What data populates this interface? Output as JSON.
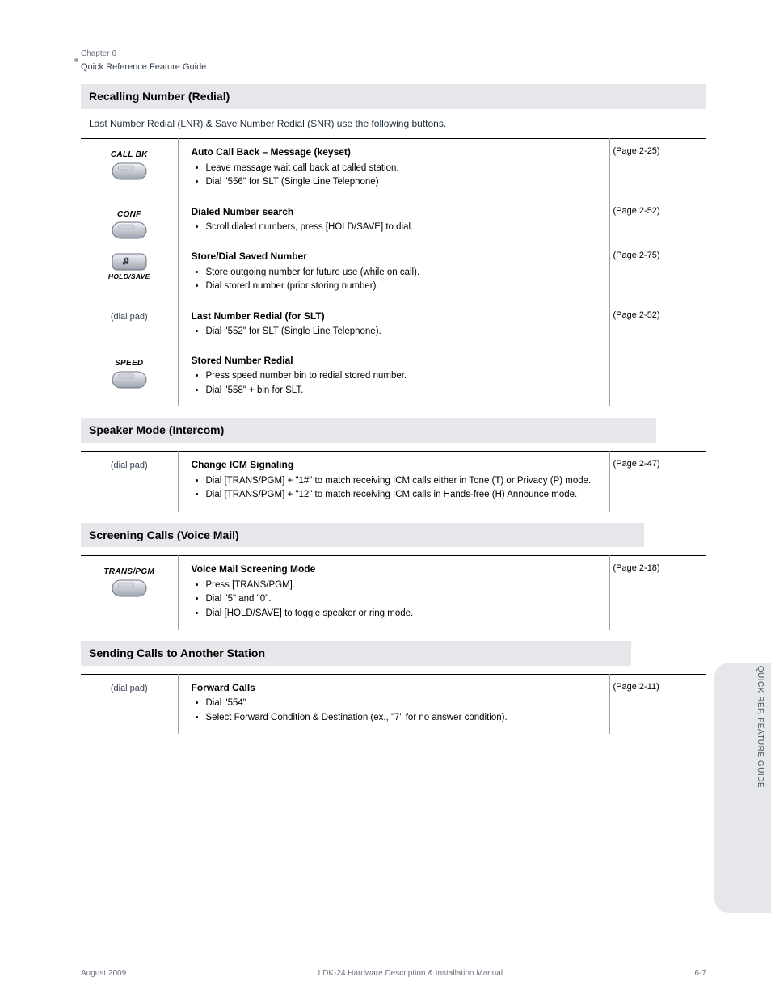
{
  "chapter": {
    "label": "Chapter 6",
    "title": "Quick Reference Feature Guide"
  },
  "sidebar_tab": "QUICK REF. FEATURE GUIDE",
  "footer": {
    "left": "August 2009",
    "center": "LDK-24 Hardware Description & Installation Manual",
    "right": "6-7"
  },
  "sections": [
    {
      "id": "recalling_redial",
      "title": "Recalling Number (Redial)",
      "width_class": "",
      "desc": "Last Number Redial (LNR) & Save Number Redial (SNR) use the following buttons.",
      "rows": [
        {
          "button_type": "image",
          "button_label": "CALL BK",
          "button_name": "call-back-button",
          "feature": "Auto Call Back – Message (keyset)",
          "items": [
            "Leave message wait call back at called station.",
            "Dial \"556\" for SLT (Single Line Telephone)"
          ],
          "ref": "(Page 2-25)"
        },
        {
          "button_type": "image",
          "button_label": "CONF",
          "button_name": "conf-button",
          "feature": "Dialed Number search",
          "items": [
            "Scroll dialed numbers, press [HOLD/SAVE] to dial."
          ],
          "ref": "(Page 2-52)"
        },
        {
          "button_type": "image",
          "button_label_top": "",
          "music_icon": true,
          "button_sublabel": "HOLD/SAVE",
          "button_name": "hold-save-button",
          "feature": "Store/Dial Saved Number",
          "items": [
            "Store outgoing number for future use (while on call).",
            "Dial stored number (prior storing number)."
          ],
          "ref": "(Page 2-75)"
        },
        {
          "button_type": "text",
          "button_text": "(dial pad)",
          "button_name": "dial-pad-label",
          "feature": "Last Number Redial (for SLT)",
          "items": [
            "Dial \"552\" for SLT (Single Line Telephone)."
          ],
          "ref": "(Page 2-52)"
        },
        {
          "button_type": "image",
          "button_label": "SPEED",
          "button_name": "speed-button",
          "feature": "Stored Number Redial",
          "items": [
            "Press speed number bin to redial stored number.",
            "Dial \"558\" + bin for SLT."
          ],
          "ref": ""
        }
      ]
    },
    {
      "id": "speaker_mode",
      "title": "Speaker Mode (Intercom)",
      "width_class": "w92",
      "desc": "",
      "rows": [
        {
          "button_type": "text",
          "button_text": "(dial pad)",
          "button_name": "dial-pad-label-2",
          "feature": "Change ICM Signaling",
          "items": [
            "Dial [TRANS/PGM] + \"1#\" to match receiving ICM calls either in Tone (T) or Privacy (P) mode.",
            "Dial [TRANS/PGM] + \"12\" to match receiving ICM calls in Hands-free (H) Announce mode."
          ],
          "ref": "(Page 2-47)"
        }
      ]
    },
    {
      "id": "screening_calls",
      "title": "Screening Calls (Voice Mail)",
      "width_class": "w90",
      "desc": "",
      "rows": [
        {
          "button_type": "image",
          "button_label": "TRANS/PGM",
          "button_name": "trans-pgm-button",
          "feature": "Voice Mail Screening Mode",
          "items": [
            "Press [TRANS/PGM].",
            "Dial \"5\" and \"0\".",
            "Dial [HOLD/SAVE] to toggle speaker or ring mode."
          ],
          "ref": "(Page 2-18)"
        }
      ]
    },
    {
      "id": "sending_calls",
      "title": "Sending Calls to Another Station",
      "width_class": "w88",
      "desc": "",
      "rows": [
        {
          "button_type": "text",
          "button_text": "(dial pad)",
          "button_name": "dial-pad-label-3",
          "feature": "Forward Calls",
          "items": [
            "Dial \"554\"",
            "Select Forward Condition & Destination (ex., \"7\" for no answer condition)."
          ],
          "ref": "(Page 2-11)"
        }
      ]
    }
  ]
}
